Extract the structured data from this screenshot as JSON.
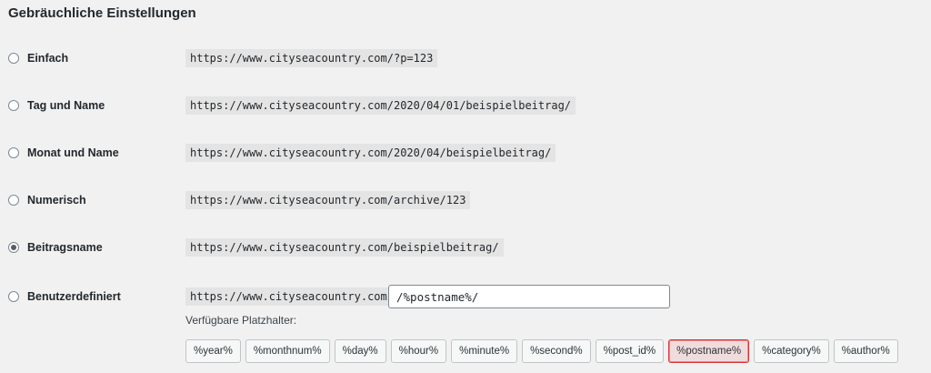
{
  "section_title": "Gebräuchliche Einstellungen",
  "options": [
    {
      "label": "Einfach",
      "example": "https://www.cityseacountry.com/?p=123",
      "checked": false
    },
    {
      "label": "Tag und Name",
      "example": "https://www.cityseacountry.com/2020/04/01/beispielbeitrag/",
      "checked": false
    },
    {
      "label": "Monat und Name",
      "example": "https://www.cityseacountry.com/2020/04/beispielbeitrag/",
      "checked": false
    },
    {
      "label": "Numerisch",
      "example": "https://www.cityseacountry.com/archive/123",
      "checked": false
    },
    {
      "label": "Beitragsname",
      "example": "https://www.cityseacountry.com/beispielbeitrag/",
      "checked": true
    },
    {
      "label": "Benutzerdefiniert",
      "example": "https://www.cityseacountry.com",
      "checked": false
    }
  ],
  "custom_structure": {
    "value": "/%postname%/"
  },
  "placeholders": {
    "label": "Verfügbare Platzhalter:",
    "tags": [
      "%year%",
      "%monthnum%",
      "%day%",
      "%hour%",
      "%minute%",
      "%second%",
      "%post_id%",
      "%postname%",
      "%category%",
      "%author%"
    ],
    "active": "%postname%"
  }
}
